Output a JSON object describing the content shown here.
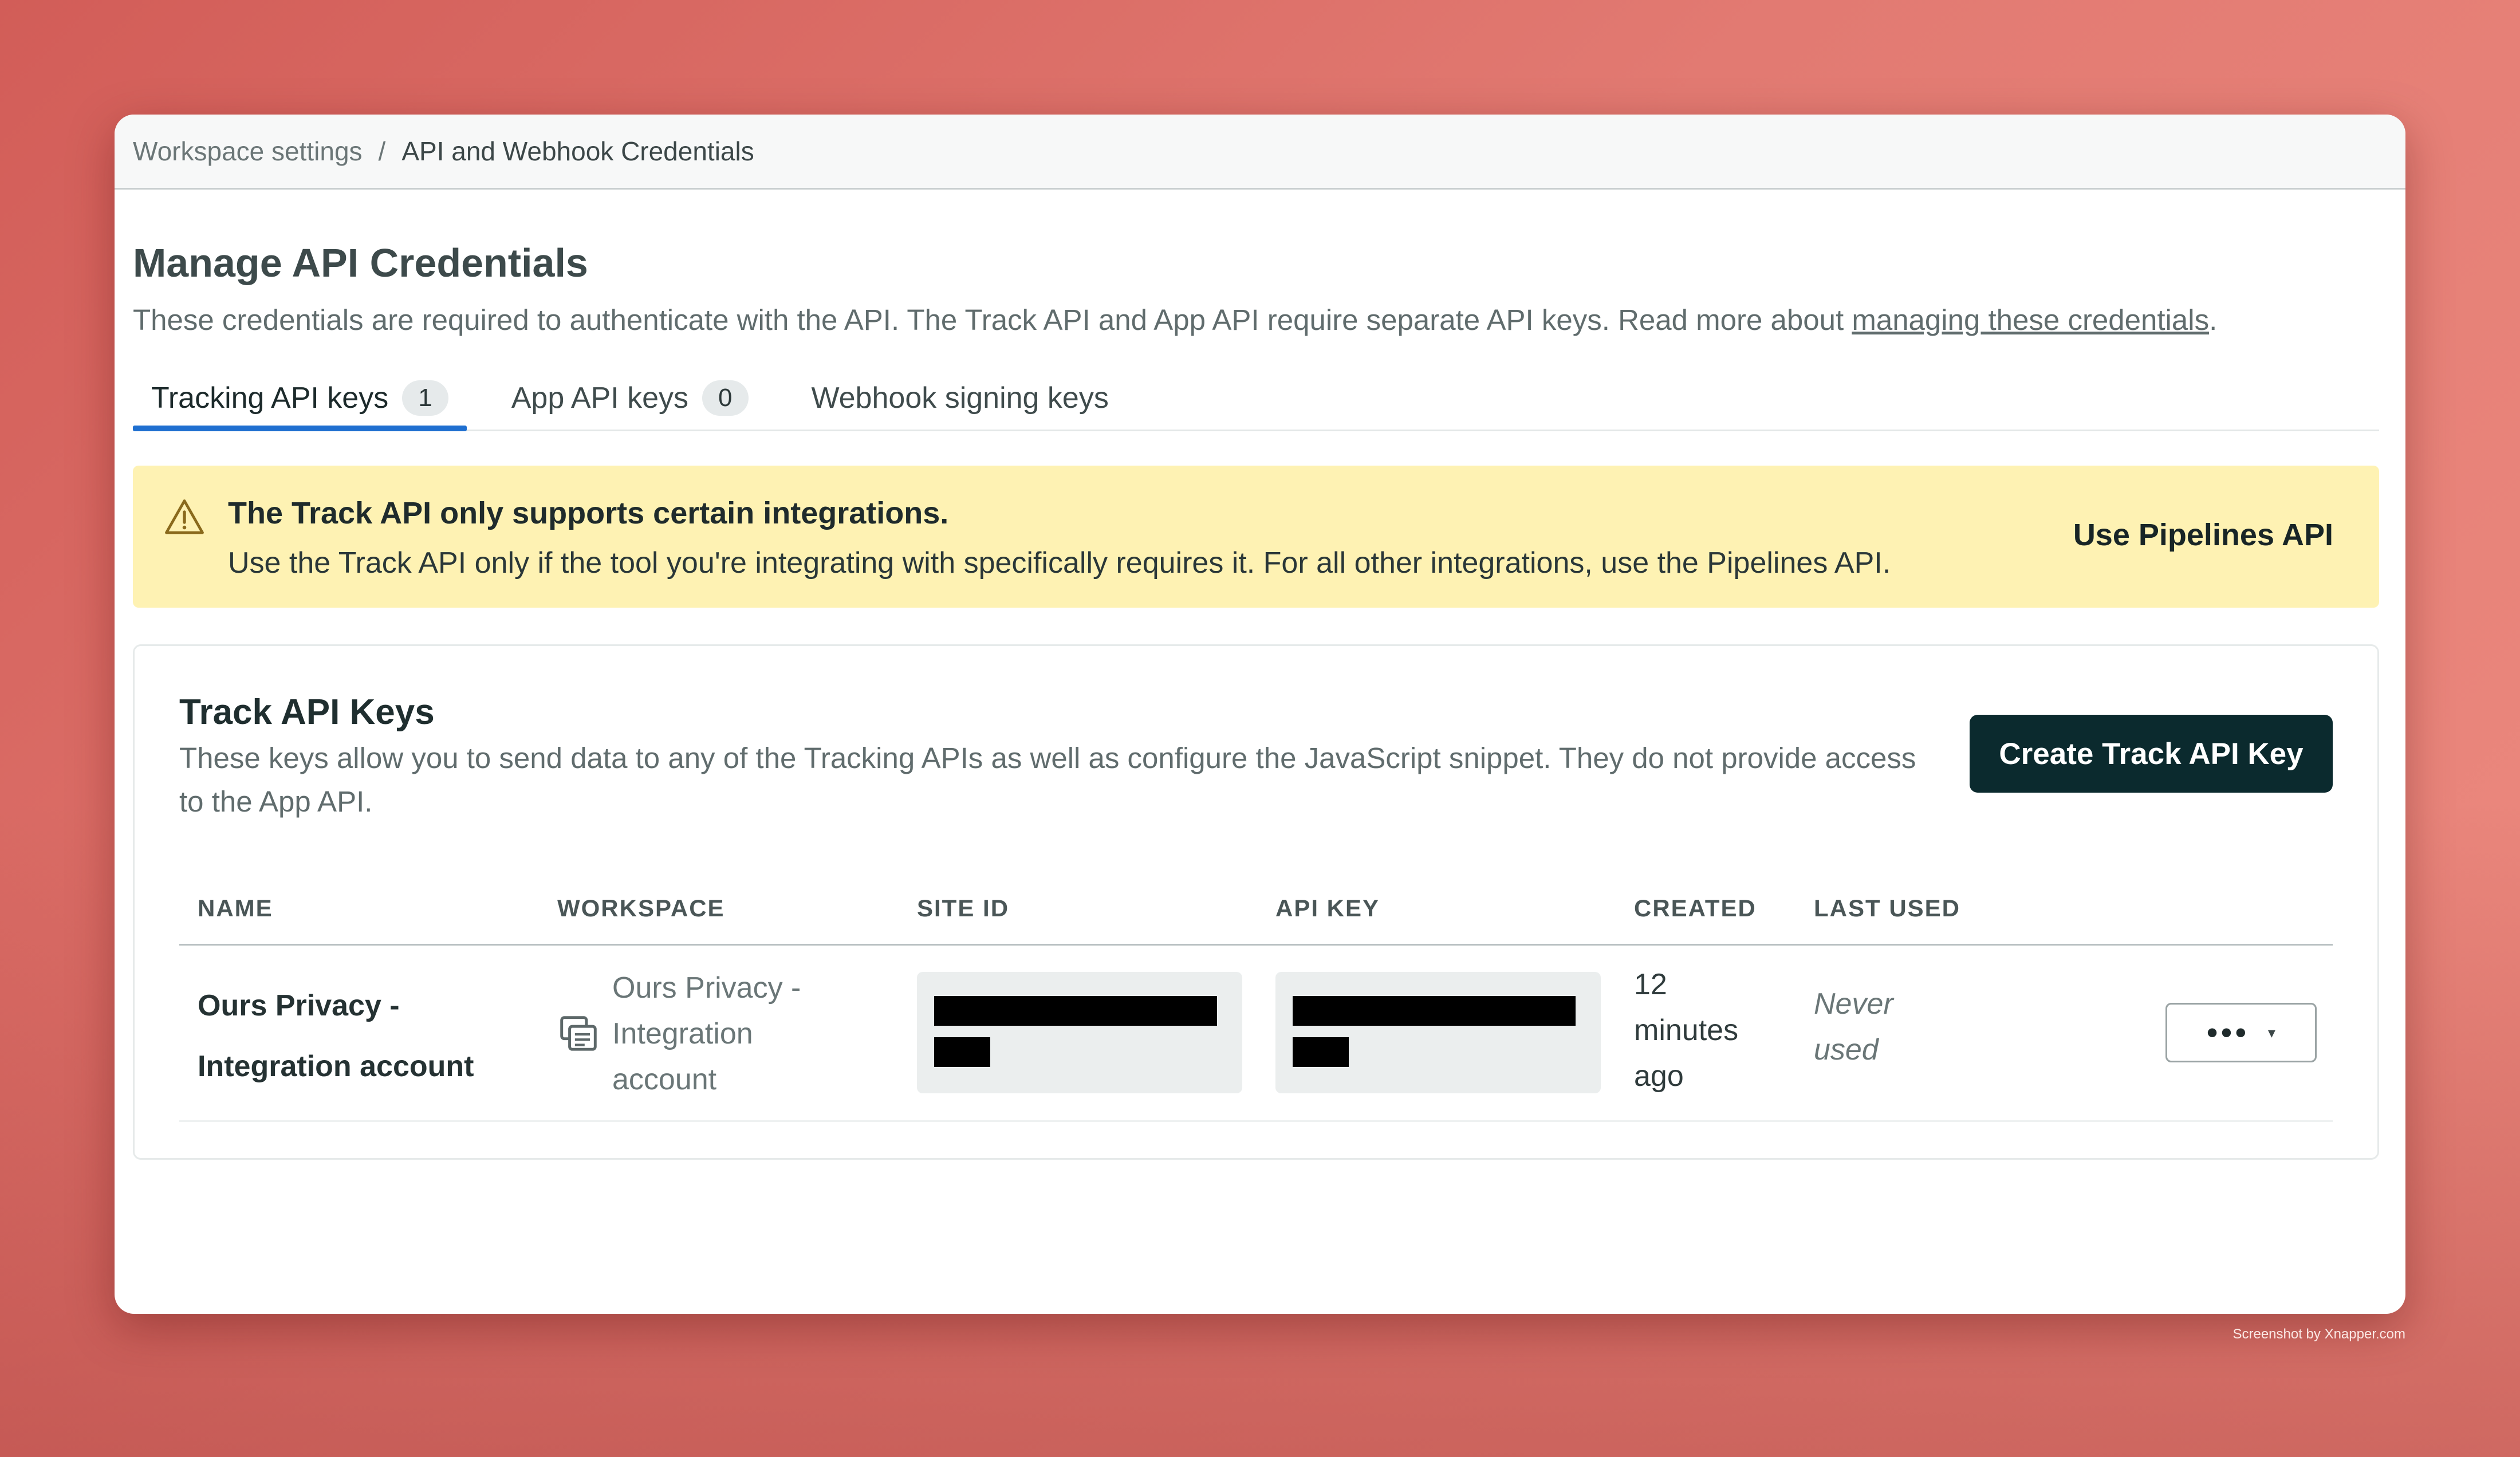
{
  "breadcrumb": {
    "parent": "Workspace settings",
    "separator": "/",
    "current": "API and Webhook Credentials"
  },
  "page": {
    "title": "Manage API Credentials",
    "description": "These credentials are required to authenticate with the API. The Track API and App API require separate API keys. Read more about ",
    "link_text": "managing these credentials",
    "description_end": "."
  },
  "tabs": [
    {
      "label": "Tracking API keys",
      "count": "1",
      "active": true
    },
    {
      "label": "App API keys",
      "count": "0",
      "active": false
    },
    {
      "label": "Webhook signing keys",
      "count": null,
      "active": false
    }
  ],
  "alert": {
    "title": "The Track API only supports certain integrations.",
    "body": "Use the Track API only if the tool you're integrating with specifically requires it. For all other integrations, use the Pipelines API.",
    "action": "Use Pipelines API",
    "icon": "warning-triangle-icon",
    "background": "#fef2b3"
  },
  "card": {
    "title": "Track API Keys",
    "description": "These keys allow you to send data to any of the Tracking APIs as well as configure the JavaScript snippet. They do not provide access to the App API.",
    "create_button": "Create Track API Key"
  },
  "table": {
    "headers": {
      "name": "NAME",
      "workspace": "WORKSPACE",
      "site_id": "SITE ID",
      "api_key": "API KEY",
      "created": "CREATED",
      "last_used": "LAST USED"
    },
    "rows": [
      {
        "name_line1": "Ours Privacy -",
        "name_line2": "Integration account",
        "workspace_line1": "Ours Privacy -",
        "workspace_line2": "Integration",
        "workspace_line3": "account",
        "site_id": "redacted",
        "api_key": "redacted",
        "created_line1": "12",
        "created_line2": "minutes",
        "created_line3": "ago",
        "last_used_line1": "Never",
        "last_used_line2": "used",
        "menu_label": "•••",
        "menu_caret": "▾"
      }
    ]
  },
  "watermark": "Screenshot by Xnapper.com",
  "colors": {
    "accent": "#1f6fd0",
    "primary_button": "#0b2a2e"
  }
}
